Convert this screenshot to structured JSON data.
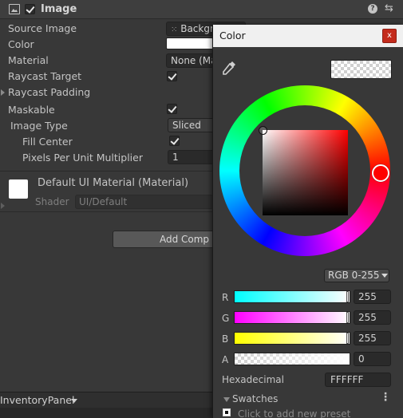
{
  "inspector": {
    "component_title": "Image",
    "rows": [
      {
        "label": "Source Image",
        "value": "Backgr",
        "type": "object-field"
      },
      {
        "label": "Color",
        "value": "",
        "type": "color-field"
      },
      {
        "label": "Material",
        "value": "None (Ma",
        "type": "object-field"
      },
      {
        "label": "Raycast Target",
        "value": "",
        "type": "checkbox"
      },
      {
        "label": "Raycast Padding",
        "value": "",
        "type": "foldout"
      },
      {
        "label": "Maskable",
        "value": "",
        "type": "checkbox"
      },
      {
        "label": "Image Type",
        "value": "Sliced",
        "type": "dropdown"
      },
      {
        "label": "Fill Center",
        "value": "",
        "type": "checkbox"
      },
      {
        "label": "Pixels Per Unit Multiplier",
        "value": "1",
        "type": "number"
      }
    ],
    "material": {
      "title": "Default UI Material (Material)",
      "shader_label": "Shader",
      "shader_value": "UI/Default"
    },
    "add_component_label": "Add Comp",
    "bottom_panel": "InventoryPanel"
  },
  "color_picker": {
    "title": "Color",
    "close_label": "x",
    "mode": "RGB 0-255",
    "channels": [
      {
        "label": "R",
        "value": "255",
        "fill": 1.0
      },
      {
        "label": "G",
        "value": "255",
        "fill": 1.0
      },
      {
        "label": "B",
        "value": "255",
        "fill": 1.0
      },
      {
        "label": "A",
        "value": "0",
        "fill": 0.0
      }
    ],
    "hex_label": "Hexadecimal",
    "hex_value": "FFFFFF",
    "swatches_label": "Swatches",
    "preset_hint": "Click to add new preset",
    "current_hue_color": "#ff0000",
    "current_color": "#ffffff"
  },
  "icons": {
    "component": "image-component-icon",
    "help": "help-icon",
    "presets": "presets-icon",
    "eyedropper": "eyedropper-icon",
    "close": "close-icon",
    "menu": "kebab-menu-icon"
  }
}
